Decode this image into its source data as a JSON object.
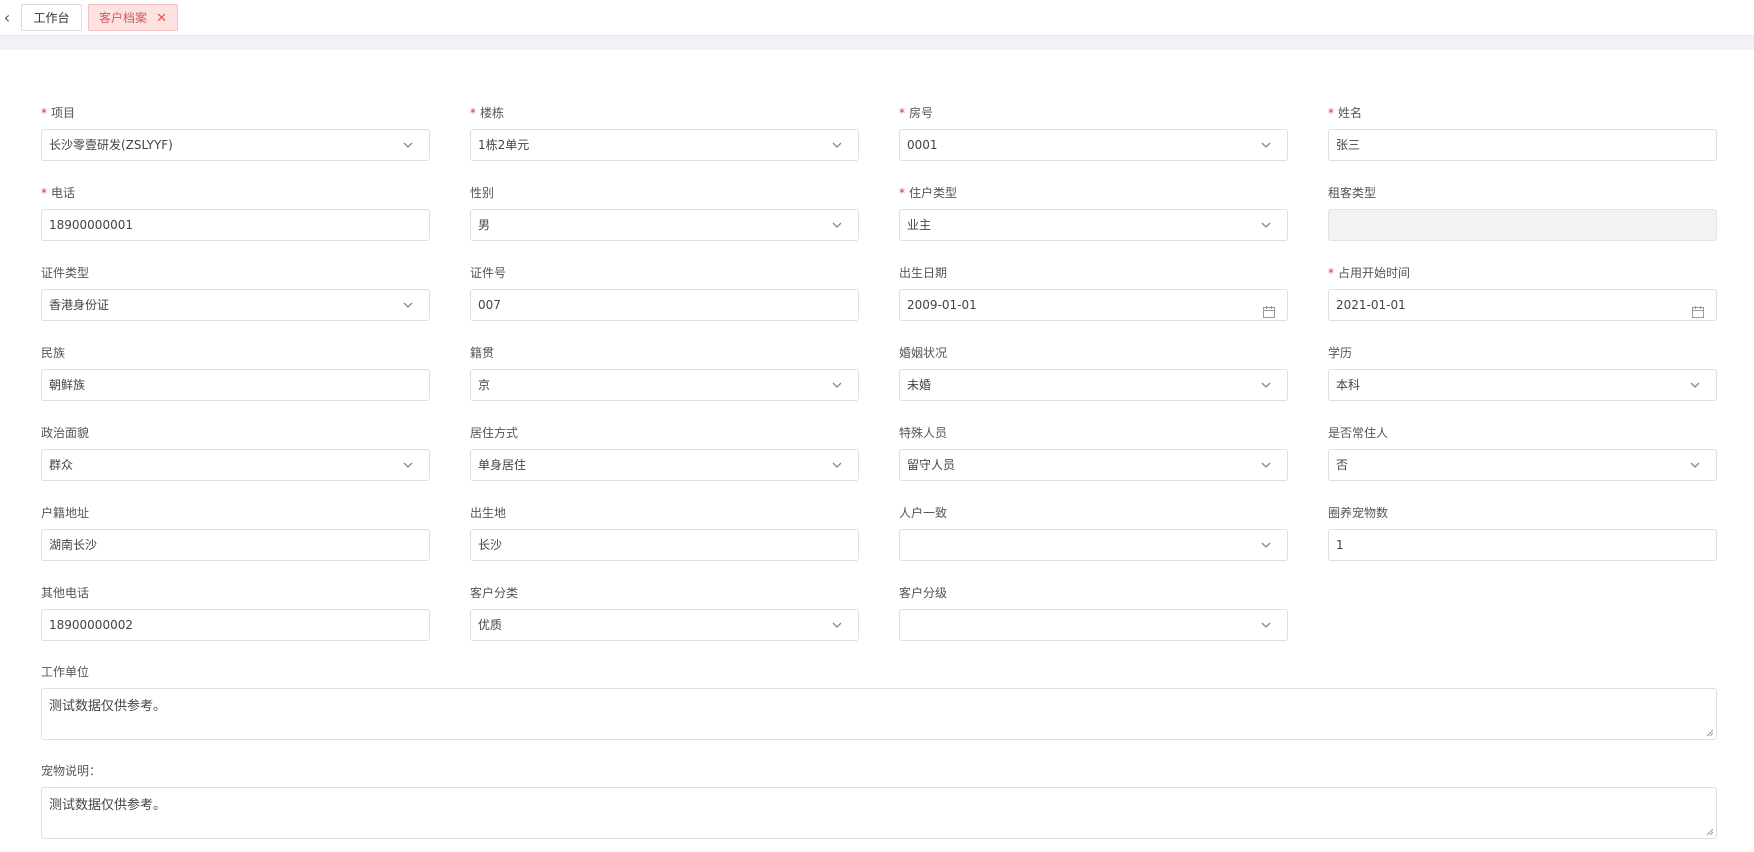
{
  "tabs": [
    {
      "label": "工作台"
    },
    {
      "label": "客户档案"
    }
  ],
  "form": {
    "rows": [
      [
        {
          "label": "项目",
          "required": true,
          "type": "select",
          "value": "长沙零壹研发(ZSLYYF)"
        },
        {
          "label": "楼栋",
          "required": true,
          "type": "select",
          "value": "1栋2单元"
        },
        {
          "label": "房号",
          "required": true,
          "type": "select",
          "value": "0001"
        },
        {
          "label": "姓名",
          "required": true,
          "type": "input",
          "value": "张三"
        }
      ],
      [
        {
          "label": "电话",
          "required": true,
          "type": "input",
          "value": "18900000001"
        },
        {
          "label": "性别",
          "required": false,
          "type": "select",
          "value": "男"
        },
        {
          "label": "住户类型",
          "required": true,
          "type": "select",
          "value": "业主"
        },
        {
          "label": "租客类型",
          "required": false,
          "type": "disabled",
          "value": ""
        }
      ],
      [
        {
          "label": "证件类型",
          "required": false,
          "type": "select",
          "value": "香港身份证"
        },
        {
          "label": "证件号",
          "required": false,
          "type": "input",
          "value": "007"
        },
        {
          "label": "出生日期",
          "required": false,
          "type": "date",
          "value": "2009-01-01"
        },
        {
          "label": "占用开始时间",
          "required": true,
          "type": "date",
          "value": "2021-01-01"
        }
      ],
      [
        {
          "label": "民族",
          "required": false,
          "type": "input",
          "value": "朝鲜族"
        },
        {
          "label": "籍贯",
          "required": false,
          "type": "select",
          "value": "京"
        },
        {
          "label": "婚姻状况",
          "required": false,
          "type": "select",
          "value": "未婚"
        },
        {
          "label": "学历",
          "required": false,
          "type": "select",
          "value": "本科"
        }
      ],
      [
        {
          "label": "政治面貌",
          "required": false,
          "type": "select",
          "value": "群众"
        },
        {
          "label": "居住方式",
          "required": false,
          "type": "select",
          "value": "单身居住"
        },
        {
          "label": "特殊人员",
          "required": false,
          "type": "select",
          "value": "留守人员"
        },
        {
          "label": "是否常住人",
          "required": false,
          "type": "select",
          "value": "否"
        }
      ],
      [
        {
          "label": "户籍地址",
          "required": false,
          "type": "input",
          "value": "湖南长沙"
        },
        {
          "label": "出生地",
          "required": false,
          "type": "input",
          "value": "长沙"
        },
        {
          "label": "人户一致",
          "required": false,
          "type": "select",
          "value": ""
        },
        {
          "label": "圈养宠物数",
          "required": false,
          "type": "input",
          "value": "1"
        }
      ],
      [
        {
          "label": "其他电话",
          "required": false,
          "type": "input",
          "value": "18900000002"
        },
        {
          "label": "客户分类",
          "required": false,
          "type": "select",
          "value": "优质"
        },
        {
          "label": "客户分级",
          "required": false,
          "type": "select",
          "value": ""
        }
      ]
    ],
    "work_unit": {
      "label": "工作单位",
      "value": "测试数据仅供参考。"
    },
    "pet_note": {
      "label": "宠物说明：",
      "value": "测试数据仅供参考。"
    }
  },
  "colors": {
    "required": "#e0342a",
    "active_tab_bg": "#fde2e2",
    "active_tab_text": "#d05c5c",
    "border": "#dcdfe6"
  },
  "icons": {
    "back": "chevron-left-icon",
    "close": "close-icon",
    "select": "chevron-down-icon",
    "date": "calendar-icon"
  }
}
